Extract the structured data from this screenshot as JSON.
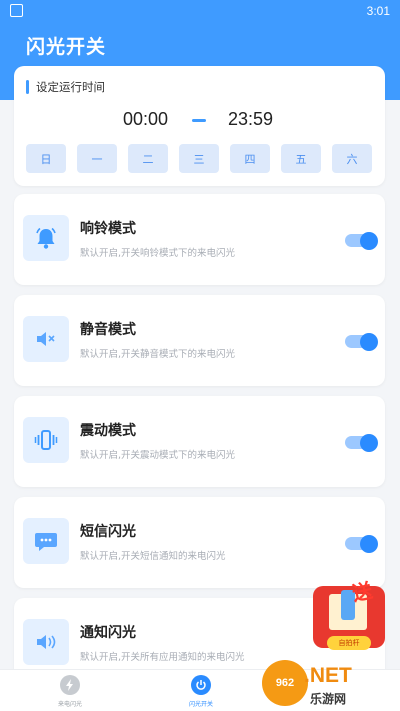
{
  "status_bar": {
    "time": "3:01"
  },
  "header": {
    "title": "闪光开关"
  },
  "schedule": {
    "title": "设定运行时间",
    "start_time": "00:00",
    "end_time": "23:59",
    "days": [
      "日",
      "一",
      "二",
      "三",
      "四",
      "五",
      "六"
    ]
  },
  "modes": [
    {
      "title": "响铃模式",
      "desc": "默认开启,开关响铃模式下的来电闪光",
      "icon": "bell-icon",
      "enabled": true
    },
    {
      "title": "静音模式",
      "desc": "默认开启,开关静音模式下的来电闪光",
      "icon": "speaker-mute-icon",
      "enabled": true
    },
    {
      "title": "震动模式",
      "desc": "默认开启,开关震动模式下的来电闪光",
      "icon": "vibrate-icon",
      "enabled": true
    },
    {
      "title": "短信闪光",
      "desc": "默认开启,开关短信通知的来电闪光",
      "icon": "chat-bubble-icon",
      "enabled": true
    },
    {
      "title": "通知闪光",
      "desc": "默认开启,开关所有应用通知的来电闪光",
      "icon": "speaker-icon",
      "enabled": true
    }
  ],
  "tabs": [
    {
      "label": "来电闪光",
      "icon": "flash-icon",
      "active": false
    },
    {
      "label": "闪光开关",
      "icon": "power-icon",
      "active": true
    }
  ],
  "promo": {
    "text": "送",
    "badge": "自拍杆"
  },
  "watermark": {
    "logo": "962",
    "domain": ".NET",
    "name": "乐游网"
  },
  "colors": {
    "accent": "#3f9bff",
    "toggle_on": "#2a8bff",
    "icon_bg": "#e4f0ff"
  }
}
